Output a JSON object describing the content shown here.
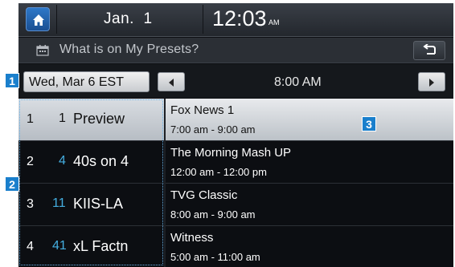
{
  "status_bar": {
    "home_icon": "home-icon",
    "date": "Jan.  1",
    "time": "12:03",
    "ampm": "AM"
  },
  "title_bar": {
    "icon": "calendar-icon",
    "title": "What is on My Presets?",
    "back_icon": "back-arrow-icon"
  },
  "date_bar": {
    "date_label": "Wed, Mar 6 EST",
    "prev_icon": "arrow-left-icon",
    "next_icon": "arrow-right-icon",
    "time_label": "8:00 AM"
  },
  "channels": [
    {
      "index": "1",
      "number": "1",
      "name": "Preview",
      "selected": true
    },
    {
      "index": "2",
      "number": "4",
      "name": "40s on 4",
      "selected": false
    },
    {
      "index": "3",
      "number": "11",
      "name": "KIIS-LA",
      "selected": false
    },
    {
      "index": "4",
      "number": "41",
      "name": "xL Factn",
      "selected": false
    }
  ],
  "programs": [
    {
      "title": "Fox News 1",
      "time": "7:00 am - 9:00 am",
      "selected": true
    },
    {
      "title": "The Morning Mash UP",
      "time": "12:00 am - 12:00 pm",
      "selected": false
    },
    {
      "title": "TVG Classic",
      "time": "8:00 am - 9:00 am",
      "selected": false
    },
    {
      "title": "Witness",
      "time": "5:00 am - 11:00 am",
      "selected": false
    }
  ],
  "callouts": {
    "c1": "1",
    "c2": "2",
    "c3": "3"
  },
  "colors": {
    "accent": "#1a7fcc",
    "channel_number": "#44aee0"
  }
}
